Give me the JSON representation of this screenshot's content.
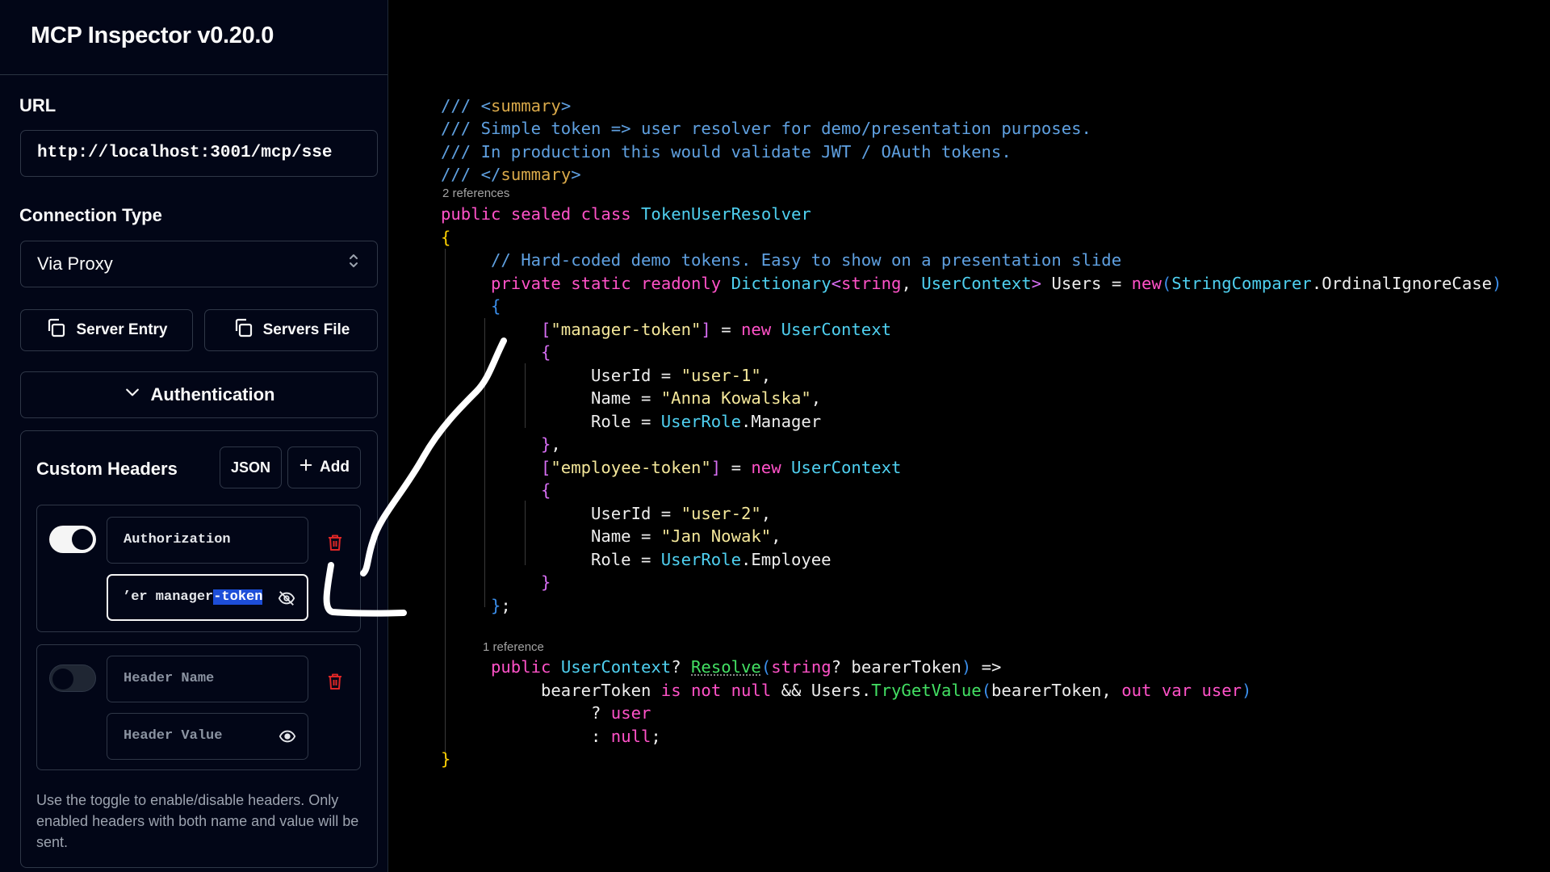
{
  "app": {
    "title": "MCP Inspector v0.20.0"
  },
  "sidebar": {
    "url_label": "URL",
    "url_value": "http://localhost:3001/mcp/sse",
    "connection_label": "Connection Type",
    "connection_value": "Via Proxy",
    "server_entry_label": "Server Entry",
    "servers_file_label": "Servers File",
    "auth_label": "Authentication",
    "custom_headers": {
      "title": "Custom Headers",
      "json_label": "JSON",
      "add_label": "Add",
      "rows": [
        {
          "enabled": true,
          "name": "Authorization",
          "value_before": "’er manager",
          "value_selected": "-token"
        },
        {
          "enabled": false,
          "name_placeholder": "Header Name",
          "value_placeholder": "Header Value"
        }
      ],
      "help_text": "Use the toggle to enable/disable headers. Only enabled headers with both name and value will be sent."
    }
  },
  "icons": [
    "copy-icon",
    "chevron-down-icon",
    "chevrons-up-down-icon",
    "plus-icon",
    "trash-icon",
    "eye-off-icon",
    "eye-icon"
  ],
  "colors": {
    "sidebar_bg": "#020617",
    "trash": "#dc2626",
    "selection": "#1d4ed8",
    "comment": "#5fa0e0",
    "keyword": "#ff52c8",
    "type": "#4fd0f0",
    "string": "#f4e79a",
    "method": "#43e063"
  },
  "code": {
    "lens_2_refs": "2 references",
    "lens_1_ref": "1 reference",
    "t": {
      "c1": "/// ",
      "c1b": "<",
      "c1c": "summary",
      "c1d": ">",
      "c2": "/// Simple token => user resolver for demo/presentation purposes.",
      "c3": "/// In production this would validate JWT / OAuth tokens.",
      "c4": "/// ",
      "c4b": "</",
      "c4c": "summary",
      "c4d": ">",
      "public": "public",
      "sealed": "sealed",
      "class": "class",
      "class_name": "TokenUserResolver",
      "lbrace": "{",
      "rbrace": "}",
      "rbrace_comma": "},",
      "rbrace_semi": "};",
      "comment_demo": "// Hard-coded demo tokens. Easy to show on a presentation slide",
      "private": "private",
      "static": "static",
      "readonly": "readonly",
      "dictionary": "Dictionary",
      "lt": "<",
      "string_kw": "string",
      "comma_sp": ", ",
      "user_context": "UserContext",
      "gt": ">",
      "users_eq": " Users = ",
      "new": "new",
      "lparen": "(",
      "string_comparer": "StringComparer",
      "ordinal": ".OrdinalIgnoreCase",
      "rparen": ")",
      "lbracket": "[",
      "rbracket": "]",
      "eq_sp": " = ",
      "manager_token": "\"manager-token\"",
      "employee_token": "\"employee-token\"",
      "user_id_eq": "UserId = ",
      "user1": "\"user-1\"",
      "user2": "\"user-2\"",
      "comma": ",",
      "name_eq": "Name = ",
      "anna": "\"Anna Kowalska\"",
      "jan": "\"Jan Nowak\"",
      "role_eq": "Role = ",
      "user_role": "UserRole",
      "manager": ".Manager",
      "employee": ".Employee",
      "qmark": "?",
      "resolve": "Resolve",
      "bearer_token": " bearerToken",
      "arrow": " =>",
      "bearer_token2": "bearerToken",
      "is": "is",
      "not": "not",
      "null": "null",
      "and": " && Users.",
      "try_get": "TryGetValue",
      "bt_comma": "bearerToken, ",
      "out": "out",
      "var": "var",
      "user": "user",
      "q_sp": "? ",
      "colon_sp": ": ",
      "semi": ";",
      "sp": " "
    }
  }
}
